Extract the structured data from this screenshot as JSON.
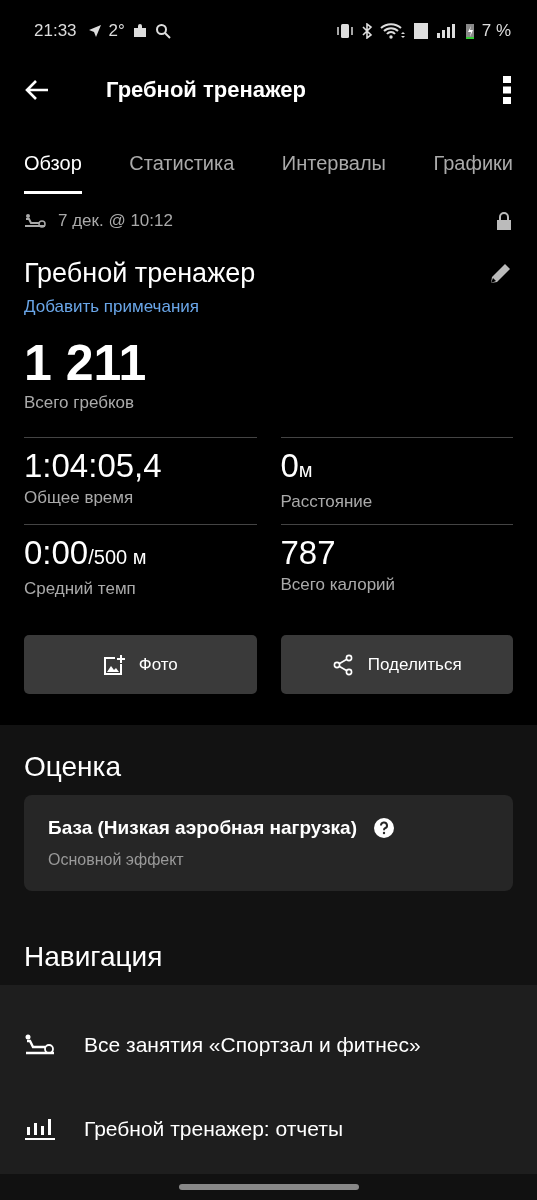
{
  "status_bar": {
    "time": "21:33",
    "temperature": "2°",
    "battery": "7 %"
  },
  "app_bar": {
    "title": "Гребной тренажер"
  },
  "tabs": [
    {
      "label": "Обзор",
      "selected": true
    },
    {
      "label": "Статистика",
      "selected": false
    },
    {
      "label": "Интервалы",
      "selected": false
    },
    {
      "label": "Графики",
      "selected": false
    }
  ],
  "activity": {
    "date": "7 дек. @ 10:12",
    "title": "Гребной тренажер",
    "notes_link": "Добавить примечания"
  },
  "total": {
    "value": "1 211",
    "label": "Всего гребков"
  },
  "stats": [
    {
      "value": "1:04:05,4",
      "label": "Общее время"
    },
    {
      "value": "0",
      "unit": "м",
      "label": "Расстояние"
    },
    {
      "value": "0:00",
      "unit": "/500 м",
      "label": "Средний темп"
    },
    {
      "value": "787",
      "label": "Всего калорий"
    }
  ],
  "buttons": [
    {
      "kind": "photo",
      "label": "Фото"
    },
    {
      "kind": "share",
      "label": "Поделиться"
    }
  ],
  "rating": {
    "heading": "Оценка",
    "title": "База (Низкая аэробная нагрузка)",
    "subtitle": "Основной эффект"
  },
  "navigation": {
    "heading": "Навигация",
    "items": [
      {
        "kind": "rower",
        "label": "Все занятия «Спортзал и фитнес»"
      },
      {
        "kind": "chart",
        "label": "Гребной тренажер: отчеты"
      }
    ]
  }
}
